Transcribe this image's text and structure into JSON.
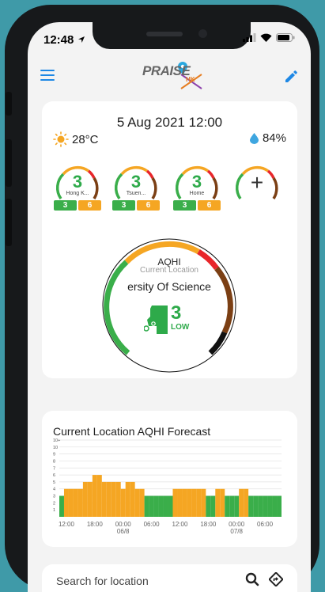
{
  "status": {
    "time": "12:48"
  },
  "header": {
    "logo_text": "PRAISE",
    "logo_sub": "HK"
  },
  "weather": {
    "datetime": "5 Aug 2021 12:00",
    "temperature": "28°C",
    "humidity": "84%"
  },
  "stations": [
    {
      "name": "Hong K...",
      "aqhi": "3",
      "low": "3",
      "high": "6"
    },
    {
      "name": "Tsuen...",
      "aqhi": "3",
      "low": "3",
      "high": "6"
    },
    {
      "name": "Home",
      "aqhi": "3",
      "low": "3",
      "high": "6"
    }
  ],
  "add_station": {
    "label": "+"
  },
  "gauge": {
    "title": "AQHI",
    "subtitle": "Current Location",
    "location": "ersity Of Science",
    "value": "3",
    "level": "LOW",
    "value_fraction": 0.3
  },
  "forecast": {
    "title": "Current Location AQHI Forecast"
  },
  "chart_data": {
    "type": "bar",
    "title": "Current Location AQHI Forecast",
    "y_ticks": [
      "10+",
      "10",
      "9",
      "8",
      "7",
      "6",
      "5",
      "4",
      "3",
      "2",
      "1"
    ],
    "ylim": [
      0,
      11
    ],
    "x_ticks": [
      {
        "label": "12:00",
        "sub": "",
        "index": 1
      },
      {
        "label": "18:00",
        "sub": "",
        "index": 7
      },
      {
        "label": "00:00",
        "sub": "06/8",
        "index": 13
      },
      {
        "label": "06:00",
        "sub": "",
        "index": 19
      },
      {
        "label": "12:00",
        "sub": "",
        "index": 25
      },
      {
        "label": "18:00",
        "sub": "",
        "index": 31
      },
      {
        "label": "00:00",
        "sub": "07/8",
        "index": 37
      },
      {
        "label": "06:00",
        "sub": "",
        "index": 43
      }
    ],
    "values": [
      3,
      4,
      4,
      4,
      4,
      5,
      5,
      6,
      6,
      5,
      5,
      5,
      5,
      4,
      5,
      5,
      4,
      4,
      3,
      3,
      3,
      3,
      3,
      3,
      4,
      4,
      4,
      4,
      4,
      4,
      4,
      3,
      3,
      4,
      4,
      3,
      3,
      3,
      4,
      4,
      3,
      3,
      3,
      3,
      3,
      3,
      3
    ],
    "colors": {
      "low": "#3aae4a",
      "moderate": "#f5a623"
    }
  },
  "search": {
    "placeholder": "Search for location"
  },
  "colors": {
    "accent": "#1e88e5",
    "low": "#3aae4a",
    "moderate": "#f5a623",
    "high": "#e8262a",
    "very_high": "#7b3f14",
    "serious": "#111111"
  }
}
